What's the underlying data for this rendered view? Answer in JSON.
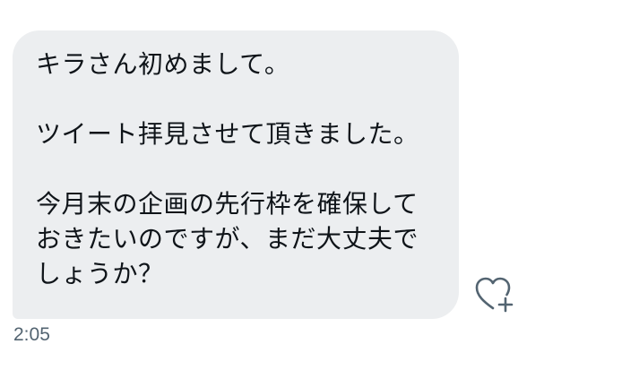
{
  "message": {
    "paragraphs": [
      [
        "キラさん初めまして。"
      ],
      [
        "ツイート拝見させて頂きました。"
      ],
      [
        "今月末の企画の先行枠を確保して",
        "おきたいのですが、まだ大丈夫で",
        "しょうか？"
      ]
    ],
    "timestamp": "2:05"
  },
  "icons": {
    "react": "heart-plus-icon"
  },
  "colors": {
    "bubble": "#eceef0",
    "text": "#0f1419",
    "timestamp": "#536471",
    "icon": "#536471"
  }
}
